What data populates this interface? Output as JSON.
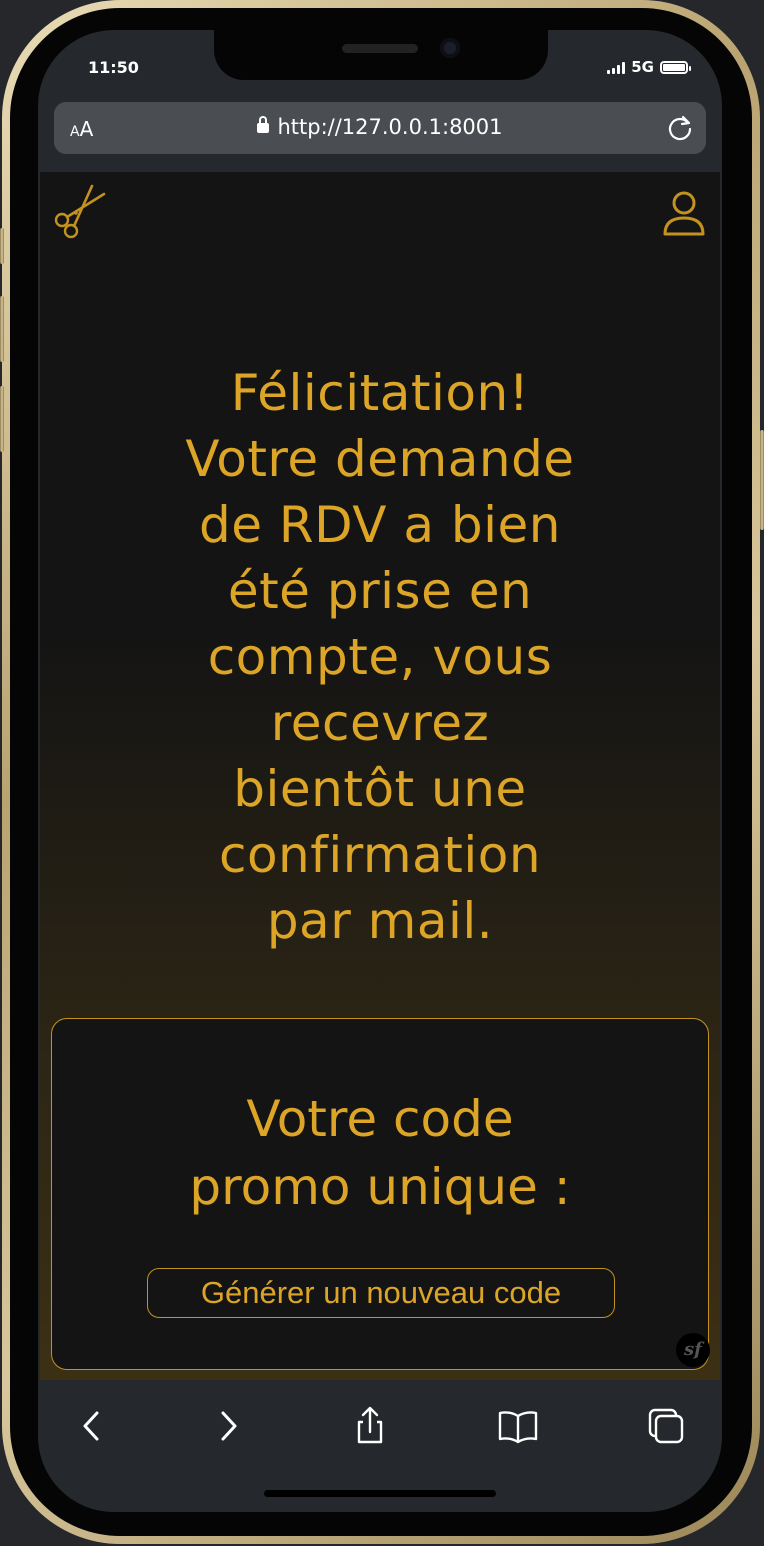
{
  "status_bar": {
    "time": "11:50",
    "network": "5G"
  },
  "browser": {
    "text_size_label": "AA",
    "url": "http://127.0.0.1:8001"
  },
  "page": {
    "headline": "Félicitation!\nVotre demande\nde RDV a bien\nété prise en\ncompte, vous\nrecevrez\nbientôt une\nconfirmation\npar mail.",
    "promo_title": "Votre code\npromo unique :",
    "generate_button": "Générer un nouveau code",
    "debug_badge": "sf"
  },
  "colors": {
    "accent": "#dca527",
    "background": "#141414"
  },
  "icons": {
    "logo": "scissors-icon",
    "account": "user-icon",
    "back": "chevron-left-icon",
    "forward": "chevron-right-icon",
    "share": "share-icon",
    "bookmarks": "book-icon",
    "tabs": "tabs-icon"
  }
}
